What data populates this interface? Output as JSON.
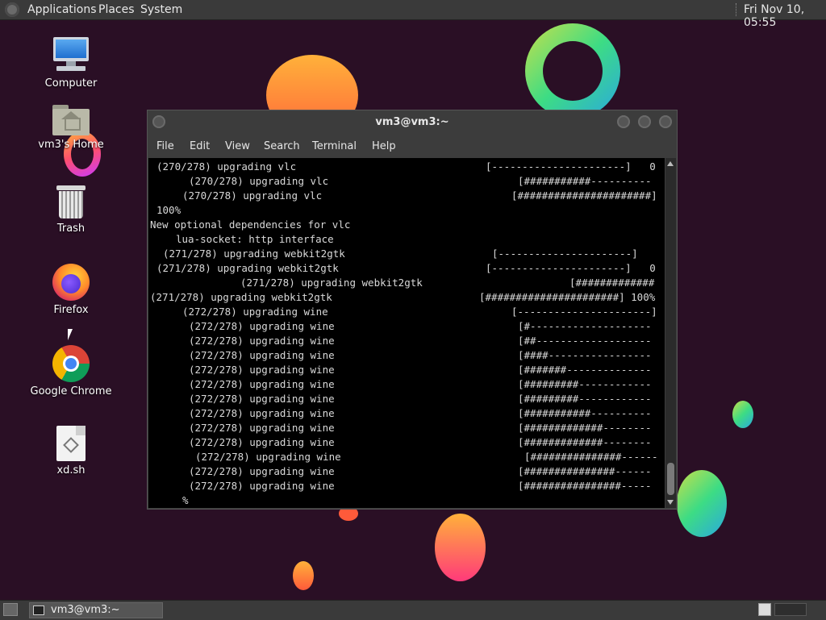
{
  "top_panel": {
    "menus": [
      "Applications",
      "Places",
      "System"
    ],
    "clock": "Fri Nov 10, 05:55"
  },
  "desktop_icons": [
    {
      "label": "Computer",
      "icon": "computer-icon"
    },
    {
      "label": "vm3's Home",
      "icon": "home-folder-icon"
    },
    {
      "label": "Trash",
      "icon": "trash-icon"
    },
    {
      "label": "Firefox",
      "icon": "firefox-icon"
    },
    {
      "label": "Google Chrome",
      "icon": "chrome-icon"
    },
    {
      "label": "xd.sh",
      "icon": "script-file-icon"
    }
  ],
  "window": {
    "title": "vm3@vm3:~",
    "menu": [
      "File",
      "Edit",
      "View",
      "Search",
      "Terminal",
      "Help"
    ]
  },
  "terminal": {
    "lines": [
      {
        "text": "(270/278) upgrading vlc",
        "bar": "[----------------------]   0"
      },
      {
        "text": "(270/278) upgrading vlc",
        "bar": "[###########----------"
      },
      {
        "text": "(270/278) upgrading vlc",
        "bar": "[######################]"
      },
      {
        "text": "100%",
        "bar": ""
      },
      {
        "text": "New optional dependencies for vlc",
        "bar": ""
      },
      {
        "text": "lua-socket: http interface",
        "bar": ""
      },
      {
        "text": "(271/278) upgrading webkit2gtk",
        "bar": "[----------------------]"
      },
      {
        "text": "(271/278) upgrading webkit2gtk",
        "bar": "[----------------------]   0"
      },
      {
        "text": "(271/278) upgrading webkit2gtk",
        "bar": "[#############"
      },
      {
        "text": "(271/278) upgrading webkit2gtk",
        "bar": "[######################] 100%"
      },
      {
        "text": "(272/278) upgrading wine",
        "bar": "[----------------------]"
      },
      {
        "text": "(272/278) upgrading wine",
        "bar": "[#--------------------"
      },
      {
        "text": "(272/278) upgrading wine",
        "bar": "[##-------------------"
      },
      {
        "text": "(272/278) upgrading wine",
        "bar": "[####-----------------"
      },
      {
        "text": "(272/278) upgrading wine",
        "bar": "[#######--------------"
      },
      {
        "text": "(272/278) upgrading wine",
        "bar": "[#########------------"
      },
      {
        "text": "(272/278) upgrading wine",
        "bar": "[#########------------"
      },
      {
        "text": "(272/278) upgrading wine",
        "bar": "[###########----------"
      },
      {
        "text": "(272/278) upgrading wine",
        "bar": "[#############--------"
      },
      {
        "text": "(272/278) upgrading wine",
        "bar": "[#############--------"
      },
      {
        "text": "(272/278) upgrading wine",
        "bar": "[###############------"
      },
      {
        "text": "(272/278) upgrading wine",
        "bar": "[###############------"
      },
      {
        "text": "(272/278) upgrading wine",
        "bar": "[################-----"
      },
      {
        "text": "%",
        "bar": ""
      }
    ]
  },
  "bottom_panel": {
    "task_label": "vm3@vm3:~"
  }
}
